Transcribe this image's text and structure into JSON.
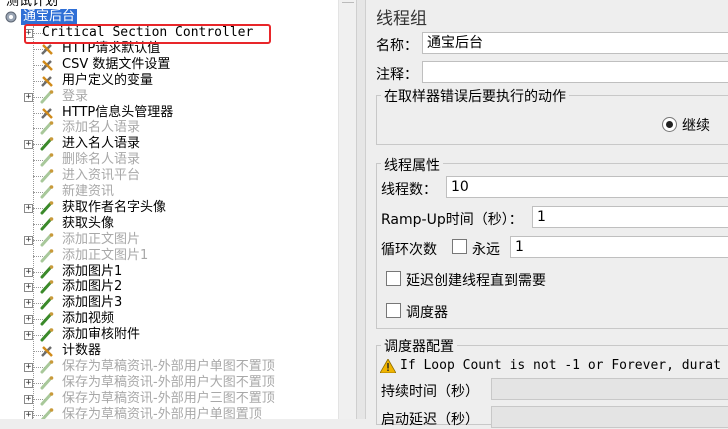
{
  "tree": {
    "root_label": "测试计划",
    "threadgroup_label": "通宝后台",
    "items": [
      {
        "label": "Critical Section Controller",
        "icon": "controller-icon",
        "disabled": false,
        "expandable": true,
        "highlighted": true
      },
      {
        "label": "HTTP请求默认值",
        "icon": "wrench-icon",
        "disabled": false,
        "expandable": false
      },
      {
        "label": "CSV 数据文件设置",
        "icon": "wrench-icon",
        "disabled": false,
        "expandable": false
      },
      {
        "label": "用户定义的变量",
        "icon": "wrench-icon",
        "disabled": false,
        "expandable": false
      },
      {
        "label": "登录",
        "icon": "sampler-icon",
        "disabled": true,
        "expandable": true
      },
      {
        "label": "HTTP信息头管理器",
        "icon": "wrench-icon",
        "disabled": false,
        "expandable": false
      },
      {
        "label": "添加名人语录",
        "icon": "sampler-icon",
        "disabled": true,
        "expandable": false
      },
      {
        "label": "进入名人语录",
        "icon": "sampler-icon",
        "disabled": false,
        "expandable": true
      },
      {
        "label": "删除名人语录",
        "icon": "sampler-icon",
        "disabled": true,
        "expandable": false
      },
      {
        "label": "进入资讯平台",
        "icon": "sampler-icon",
        "disabled": true,
        "expandable": false
      },
      {
        "label": "新建资讯",
        "icon": "sampler-icon",
        "disabled": true,
        "expandable": false
      },
      {
        "label": "获取作者名字头像",
        "icon": "sampler-icon",
        "disabled": false,
        "expandable": true
      },
      {
        "label": "获取头像",
        "icon": "sampler-icon",
        "disabled": false,
        "expandable": false
      },
      {
        "label": "添加正文图片",
        "icon": "sampler-icon",
        "disabled": true,
        "expandable": true
      },
      {
        "label": "添加正文图片1",
        "icon": "sampler-icon",
        "disabled": true,
        "expandable": false
      },
      {
        "label": "添加图片1",
        "icon": "sampler-icon",
        "disabled": false,
        "expandable": true
      },
      {
        "label": "添加图片2",
        "icon": "sampler-icon",
        "disabled": false,
        "expandable": true
      },
      {
        "label": "添加图片3",
        "icon": "sampler-icon",
        "disabled": false,
        "expandable": true
      },
      {
        "label": "添加视频",
        "icon": "sampler-icon",
        "disabled": false,
        "expandable": true
      },
      {
        "label": "添加审核附件",
        "icon": "sampler-icon",
        "disabled": false,
        "expandable": true
      },
      {
        "label": "计数器",
        "icon": "wrench-icon",
        "disabled": false,
        "expandable": false
      },
      {
        "label": "保存为草稿资讯-外部用户单图不置顶",
        "icon": "sampler-icon",
        "disabled": true,
        "expandable": true
      },
      {
        "label": "保存为草稿资讯-外部用户大图不置顶",
        "icon": "sampler-icon",
        "disabled": true,
        "expandable": true
      },
      {
        "label": "保存为草稿资讯-外部用户三图不置顶",
        "icon": "sampler-icon",
        "disabled": true,
        "expandable": true
      },
      {
        "label": "保存为草稿资讯-外部用户单图置顶",
        "icon": "sampler-icon",
        "disabled": true,
        "expandable": true
      }
    ]
  },
  "panel": {
    "title": "线程组",
    "name_label": "名称：",
    "name_value": "通宝后台",
    "comment_label": "注释：",
    "comment_value": "",
    "error_action_title": "在取样器错误后要执行的动作",
    "continue_label": "继续",
    "thread_props_title": "线程属性",
    "threads_label": "线程数：",
    "threads_value": "10",
    "rampup_label": "Ramp-Up时间（秒）：",
    "rampup_value": "1",
    "loop_label": "循环次数",
    "forever_label": "永远",
    "loop_value": "1",
    "delay_create_label": "延迟创建线程直到需要",
    "scheduler_label": "调度器",
    "scheduler_config_title": "调度器配置",
    "warning_text": "If Loop Count is not -1 or Forever, durat",
    "duration_label": "持续时间（秒）",
    "startup_delay_label": "启动延迟（秒）"
  },
  "colors": {
    "highlight": "#e8262a",
    "selected_bg": "#2f6fd6"
  }
}
